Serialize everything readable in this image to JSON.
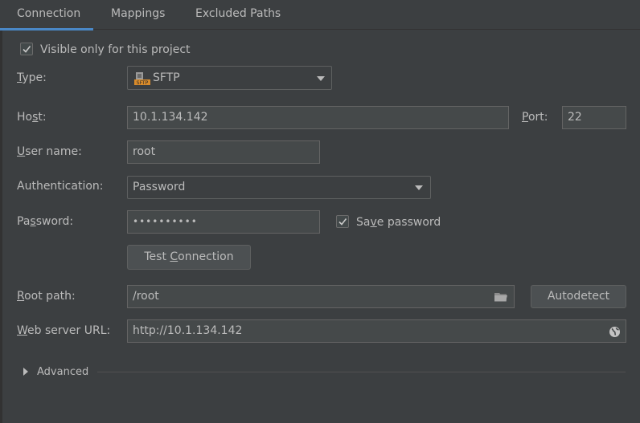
{
  "tabs": [
    {
      "label": "Connection",
      "active": true
    },
    {
      "label": "Mappings",
      "active": false
    },
    {
      "label": "Excluded Paths",
      "active": false
    }
  ],
  "visible_only": {
    "label": "Visible only for this project",
    "checked": true
  },
  "type": {
    "label": "Type:",
    "value": "SFTP",
    "icon": "sftp-icon"
  },
  "host": {
    "label": "Host:",
    "value": "10.1.134.142"
  },
  "port": {
    "label": "Port:",
    "value": "22"
  },
  "username": {
    "label": "User name:",
    "value": "root"
  },
  "authentication": {
    "label": "Authentication:",
    "value": "Password"
  },
  "password": {
    "label": "Password:",
    "value": "••••••••••"
  },
  "save_password": {
    "label": "Save password",
    "checked": true
  },
  "test_connection": {
    "label": "Test Connection"
  },
  "root_path": {
    "label": "Root path:",
    "value": "/root",
    "icon": "folder-icon"
  },
  "autodetect": {
    "label": "Autodetect"
  },
  "web_server_url": {
    "label": "Web server URL:",
    "value": "http://10.1.134.142",
    "icon": "globe-icon"
  },
  "advanced": {
    "label": "Advanced"
  },
  "colors": {
    "background": "#3c3f41",
    "accent": "#4a88c7",
    "field_bg": "#45494a",
    "text": "#bbbbbb"
  }
}
